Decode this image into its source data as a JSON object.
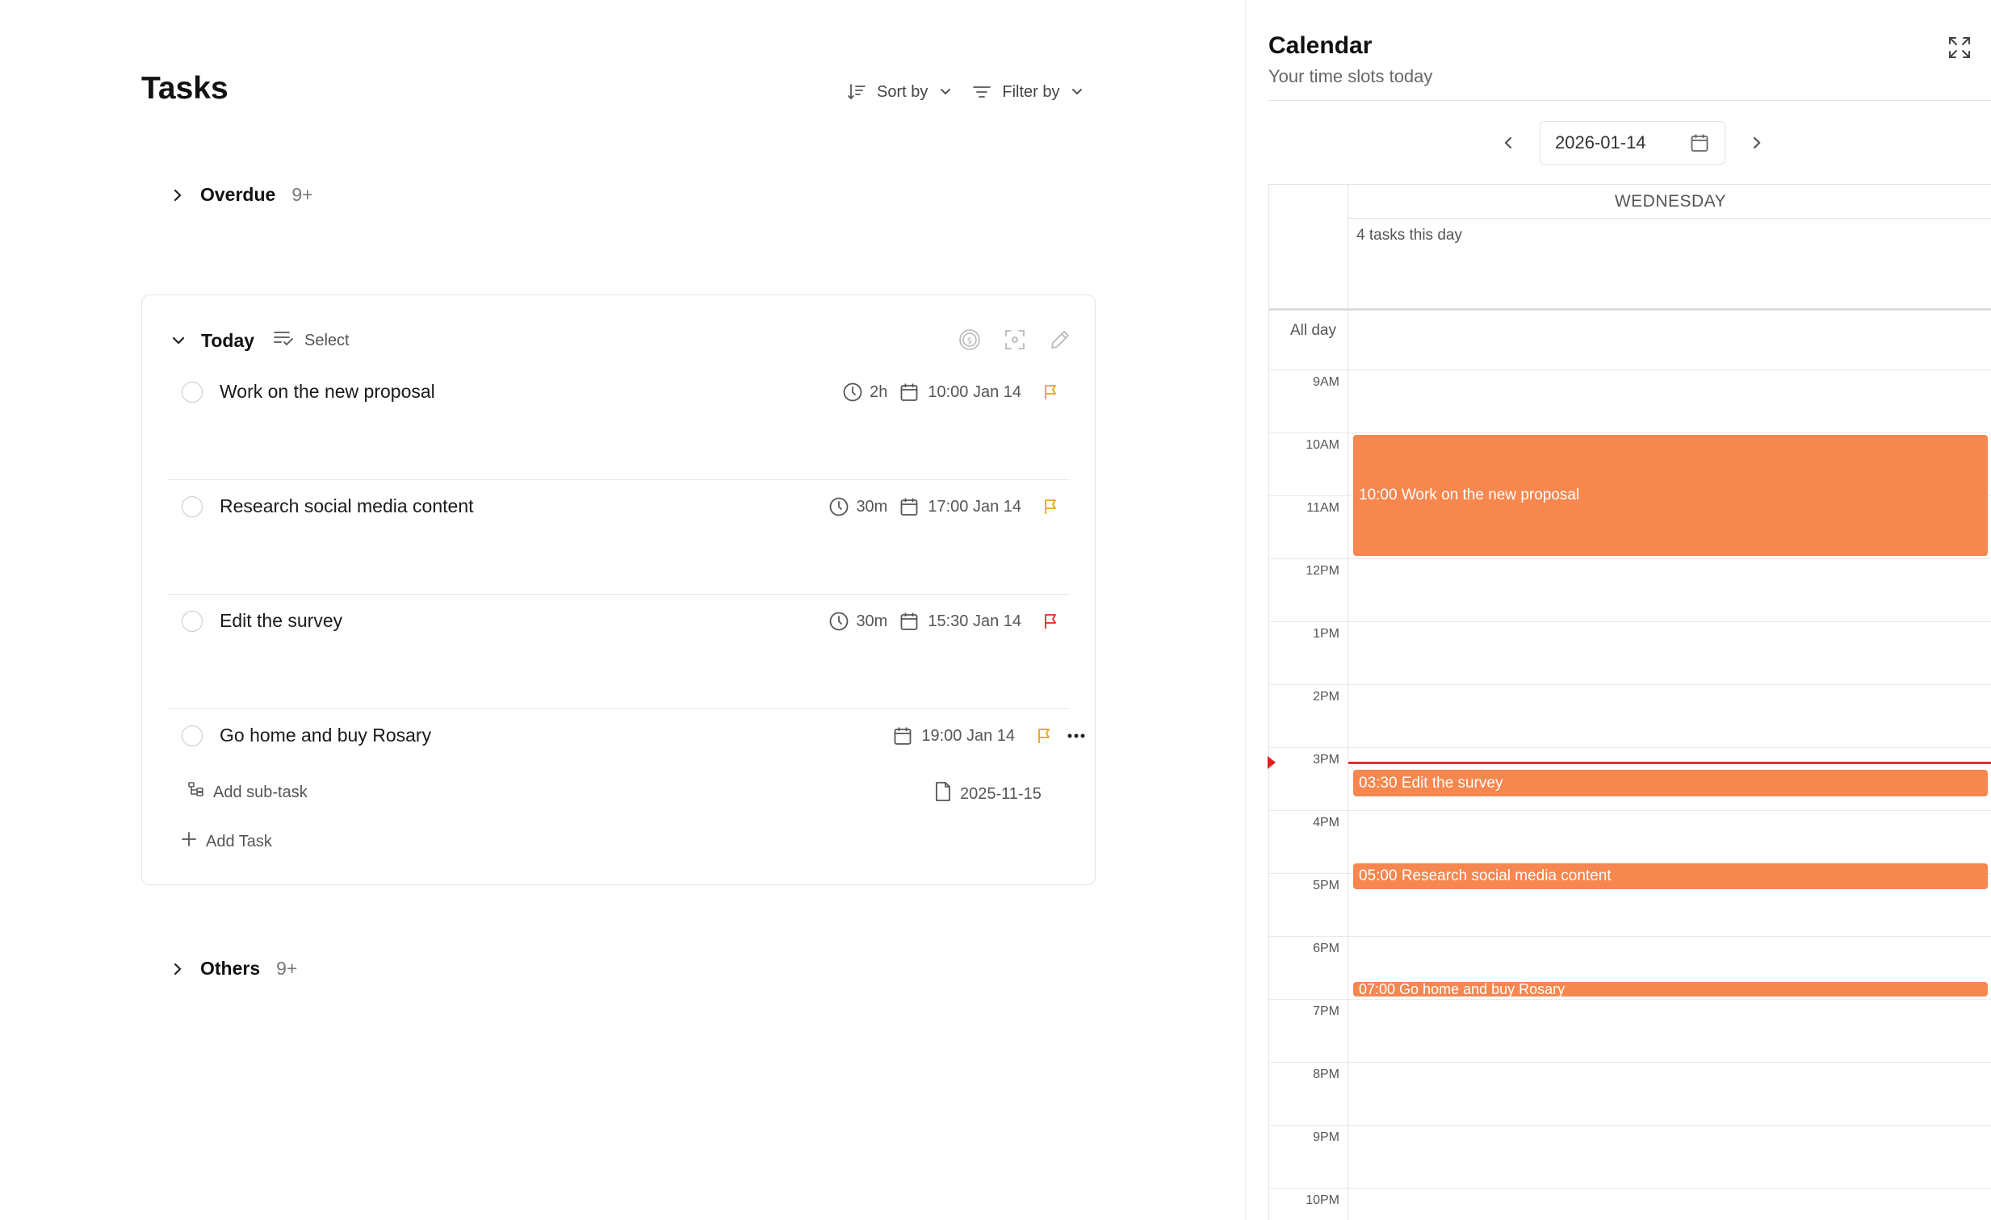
{
  "tasks_panel": {
    "title": "Tasks",
    "sort_label": "Sort by",
    "filter_label": "Filter by",
    "groups": {
      "overdue": {
        "label": "Overdue",
        "count": "9+"
      },
      "today": {
        "label": "Today",
        "select_label": "Select"
      },
      "others": {
        "label": "Others",
        "count": "9+"
      }
    },
    "today_tasks": [
      {
        "name": "Work on the new proposal",
        "duration": "2h",
        "due": "10:00 Jan 14",
        "flag_color": "#e8a317"
      },
      {
        "name": "Research social media content",
        "duration": "30m",
        "due": "17:00 Jan 14",
        "flag_color": "#e8a317"
      },
      {
        "name": "Edit the survey",
        "duration": "30m",
        "due": "15:30 Jan 14",
        "flag_color": "#e02424"
      },
      {
        "name": "Go home and buy Rosary",
        "duration": "",
        "due": "19:00 Jan 14",
        "flag_color": "#e8a317",
        "add_subtask_label": "Add sub-task",
        "file_date": "2025-11-15"
      }
    ],
    "add_task_label": "Add Task"
  },
  "calendar": {
    "title": "Calendar",
    "subtitle": "Your time slots today",
    "date_value": "2026-01-14",
    "day_name": "WEDNESDAY",
    "tasks_count_label": "4 tasks this day",
    "all_day_label": "All day",
    "hours": [
      "9AM",
      "10AM",
      "11AM",
      "12PM",
      "1PM",
      "2PM",
      "3PM",
      "4PM",
      "5PM",
      "6PM",
      "7PM",
      "8PM",
      "9PM",
      "10PM"
    ],
    "events": [
      {
        "label": "10:00 Work on the new proposal"
      },
      {
        "label": "03:30 Edit the survey"
      },
      {
        "label": "05:00 Research social media content"
      },
      {
        "label": "07:00 Go home and buy Rosary"
      }
    ],
    "accent_color": "#f5874f",
    "now_indicator_color": "#e03030"
  }
}
